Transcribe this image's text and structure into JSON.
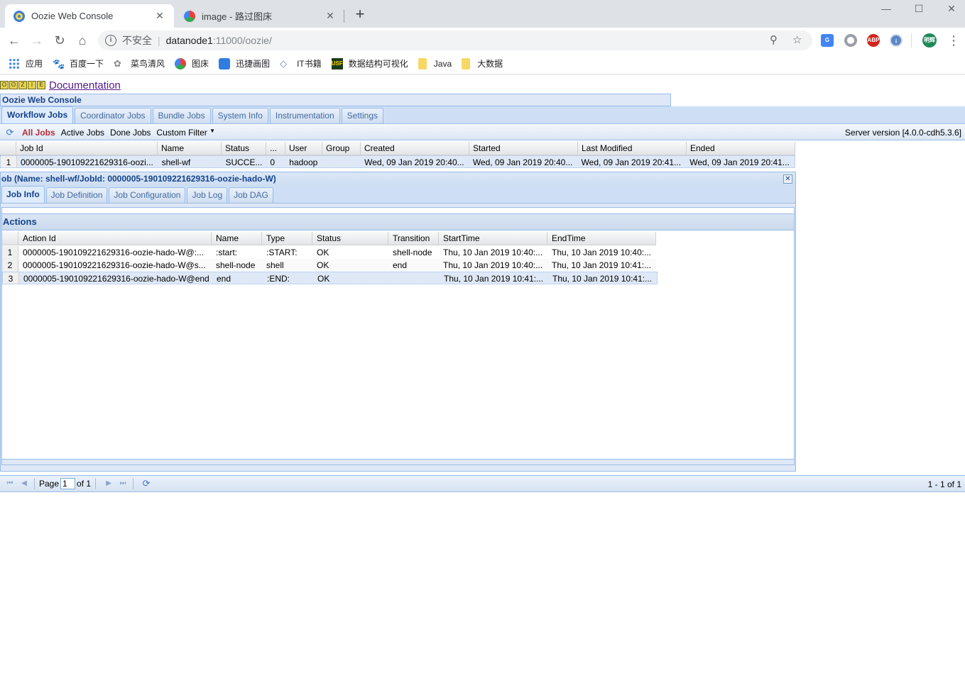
{
  "browser": {
    "tabs": [
      {
        "title": "Oozie Web Console",
        "active": true
      },
      {
        "title": "image - 路过图床",
        "active": false
      }
    ],
    "url_insecure_label": "不安全",
    "url_host": "datanode1",
    "url_rest": ":11000/oozie/",
    "bookmarks": [
      "应用",
      "百度一下",
      "菜鸟清风",
      "图床",
      "迅捷画图",
      "IT书籍",
      "数据结构可视化",
      "Java",
      "大数据"
    ],
    "profile_label": "明辉",
    "ext_abp": "ABP",
    "ext_usf": "USF"
  },
  "page": {
    "logo_letters": [
      "O",
      "O",
      "Z",
      "I",
      "E"
    ],
    "documentation_link": "Documentation",
    "console_title": "Oozie Web Console",
    "main_tabs": [
      "Workflow Jobs",
      "Coordinator Jobs",
      "Bundle Jobs",
      "System Info",
      "Instrumentation",
      "Settings"
    ],
    "filters": [
      "All Jobs",
      "Active Jobs",
      "Done Jobs",
      "Custom Filter"
    ],
    "server_version": "Server version [4.0.0-cdh5.3.6]",
    "jobs_columns": [
      "Job Id",
      "Name",
      "Status",
      "...",
      "User",
      "Group",
      "Created",
      "Started",
      "Last Modified",
      "Ended"
    ],
    "jobs_rows": [
      {
        "num": "1",
        "job_id": "0000005-190109221629316-oozi...",
        "name": "shell-wf",
        "status": "SUCCE...",
        "run": "0",
        "user": "hadoop",
        "group": "",
        "created": "Wed, 09 Jan 2019 20:40...",
        "started": "Wed, 09 Jan 2019 20:40...",
        "last_modified": "Wed, 09 Jan 2019 20:41...",
        "ended": "Wed, 09 Jan 2019 20:41..."
      }
    ],
    "job_window_title": "ob (Name: shell-wf/JobId: 0000005-190109221629316-oozie-hado-W)",
    "job_tabs": [
      "Job Info",
      "Job Definition",
      "Job Configuration",
      "Job Log",
      "Job DAG"
    ],
    "actions_title": "Actions",
    "actions_columns": [
      "Action Id",
      "Name",
      "Type",
      "Status",
      "Transition",
      "StartTime",
      "EndTime"
    ],
    "actions_rows": [
      {
        "num": "1",
        "action_id": "0000005-190109221629316-oozie-hado-W@:...",
        "name": ":start:",
        "type": ":START:",
        "status": "OK",
        "transition": "shell-node",
        "start": "Thu, 10 Jan 2019 10:40:...",
        "end": "Thu, 10 Jan 2019 10:40:..."
      },
      {
        "num": "2",
        "action_id": "0000005-190109221629316-oozie-hado-W@s...",
        "name": "shell-node",
        "type": "shell",
        "status": "OK",
        "transition": "end",
        "start": "Thu, 10 Jan 2019 10:40:...",
        "end": "Thu, 10 Jan 2019 10:41:..."
      },
      {
        "num": "3",
        "action_id": "0000005-190109221629316-oozie-hado-W@end",
        "name": "end",
        "type": ":END:",
        "status": "OK",
        "transition": "",
        "start": "Thu, 10 Jan 2019 10:41:...",
        "end": "Thu, 10 Jan 2019 10:41:..."
      }
    ],
    "pager": {
      "page_label": "Page",
      "page_value": "1",
      "of_label": "of 1",
      "info": "1 - 1 of 1"
    }
  }
}
